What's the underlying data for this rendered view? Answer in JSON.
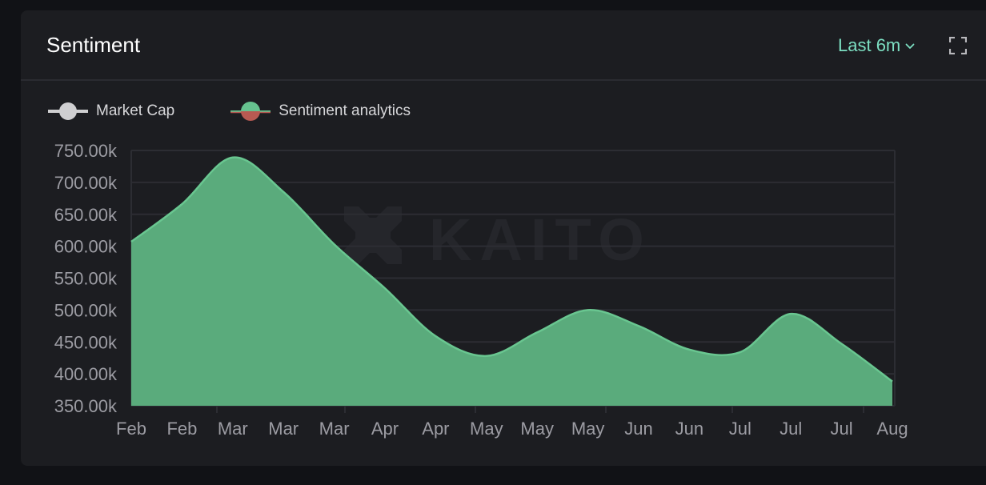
{
  "header": {
    "title": "Sentiment",
    "range_label": "Last 6m",
    "icons": {
      "range_chevron": "chevron-down-icon",
      "expand": "fullscreen-icon"
    }
  },
  "legend": [
    {
      "label": "Market Cap",
      "marker": "line-circle",
      "color": "#cfcfd1"
    },
    {
      "label": "Sentiment analytics",
      "marker": "line-circle-split",
      "color_top": "#66c28f",
      "color_bottom": "#b85a52"
    }
  ],
  "watermark": "KAITO",
  "colors": {
    "area_fill": "#5aab7c",
    "area_stroke": "#69c690",
    "grid": "#2c2d33",
    "accent": "#7de0c3"
  },
  "chart_data": {
    "type": "area",
    "title": "Sentiment",
    "xlabel": "",
    "ylabel": "",
    "categories": [
      "Feb",
      "Feb",
      "Mar",
      "Mar",
      "Mar",
      "Apr",
      "Apr",
      "May",
      "May",
      "May",
      "Jun",
      "Jun",
      "Jul",
      "Jul",
      "Jul",
      "Aug"
    ],
    "yticks": [
      "750.00k",
      "700.00k",
      "650.00k",
      "600.00k",
      "550.00k",
      "500.00k",
      "450.00k",
      "400.00k",
      "350.00k"
    ],
    "ylim": [
      350000,
      750000
    ],
    "grid": true,
    "legend_position": "top-left",
    "series": [
      {
        "name": "Sentiment analytics",
        "values": [
          607000,
          666000,
          739000,
          685000,
          603000,
          534000,
          459000,
          428000,
          465000,
          500000,
          475000,
          438000,
          434000,
          494000,
          447000,
          388000
        ]
      }
    ]
  }
}
